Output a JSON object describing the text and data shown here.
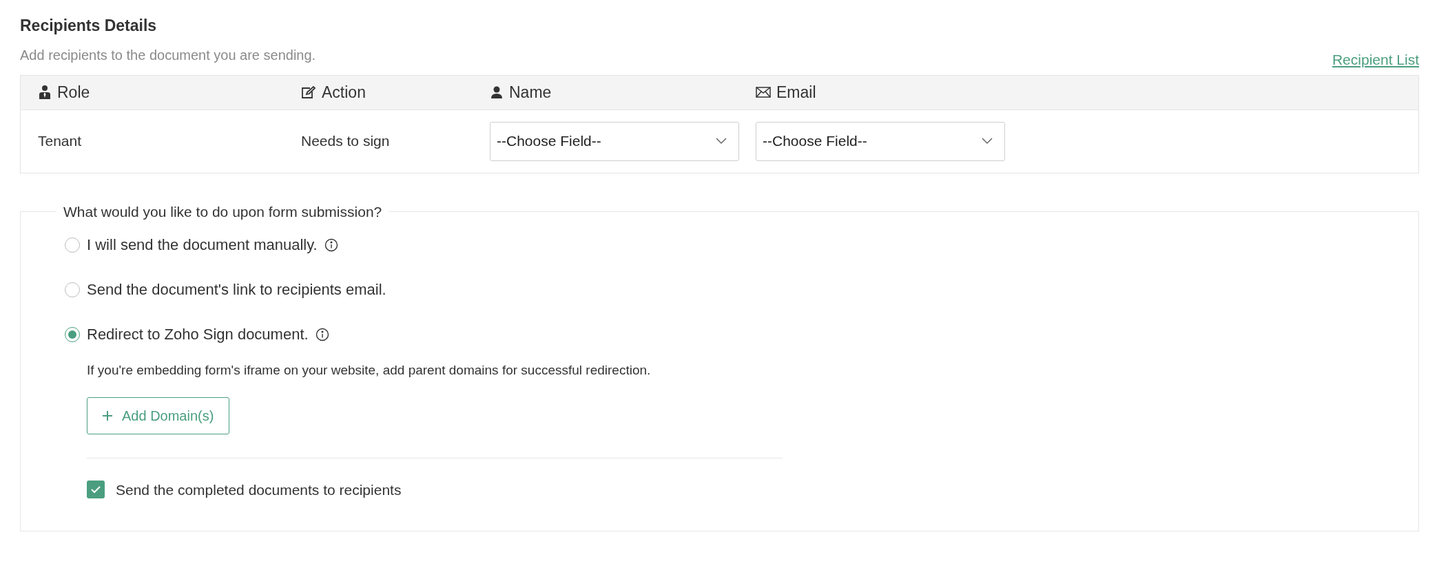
{
  "header": {
    "title": "Recipients Details",
    "subtitle": "Add recipients to the document you are sending.",
    "link": "Recipient List"
  },
  "table": {
    "columns": [
      {
        "label": "Role"
      },
      {
        "label": "Action"
      },
      {
        "label": "Name"
      },
      {
        "label": "Email"
      }
    ],
    "rows": [
      {
        "role": "Tenant",
        "action": "Needs to sign",
        "name_select": "--Choose Field--",
        "email_select": "--Choose Field--"
      }
    ]
  },
  "submission": {
    "legend": "What would you like to do upon form submission?",
    "options": [
      {
        "label": "I will send the document manually.",
        "info": true,
        "selected": false
      },
      {
        "label": "Send the document's link to recipients email.",
        "info": false,
        "selected": false
      },
      {
        "label": "Redirect to Zoho Sign document.",
        "info": true,
        "selected": true
      }
    ],
    "hint": "If you're embedding form's iframe on your website, add parent domains for successful redirection.",
    "add_button": "Add Domain(s)",
    "checkbox": {
      "label": "Send the completed documents to recipients",
      "checked": true
    }
  }
}
